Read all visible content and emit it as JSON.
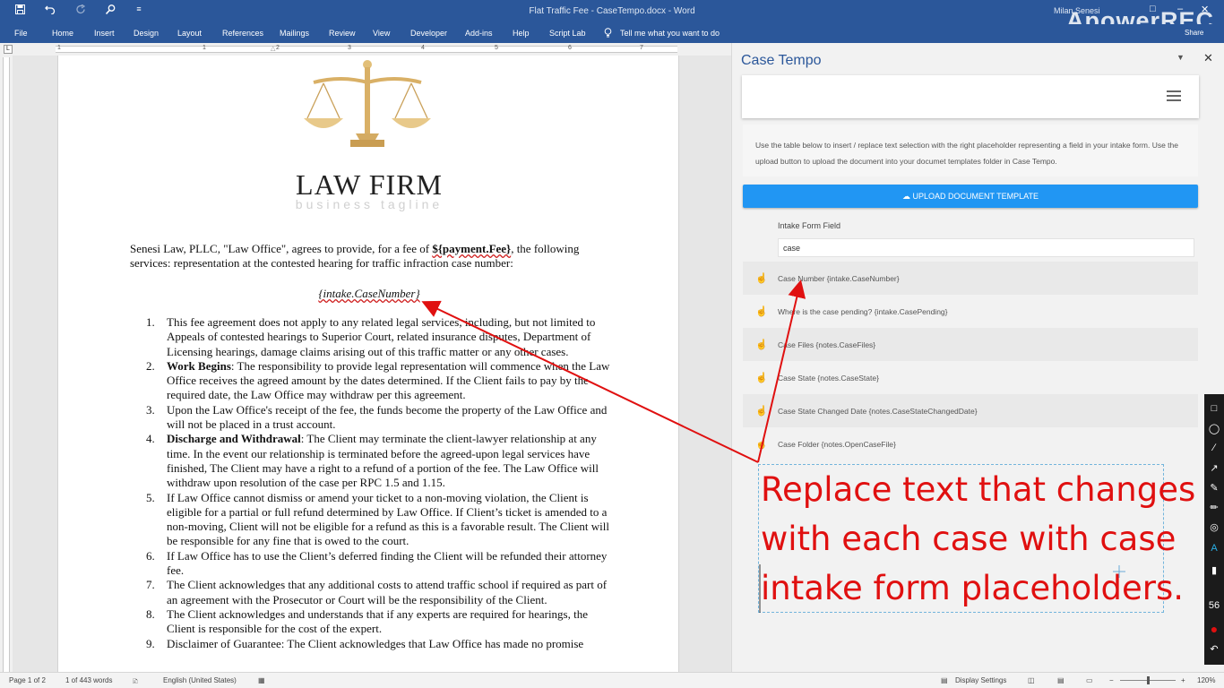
{
  "titlebar": {
    "save_icon": "save-icon",
    "undo_icon": "undo-icon",
    "redo_icon": "redo-icon",
    "touch_icon": "touch-mode-icon",
    "customize_icon": "customize-icon",
    "title": "Flat Traffic Fee - CaseTempo.docx - Word",
    "user": "Milan Senesi",
    "watermark": "ApowerREC",
    "share": "Share"
  },
  "ribbon": {
    "tabs": [
      "File",
      "Home",
      "Insert",
      "Design",
      "Layout",
      "References",
      "Mailings",
      "Review",
      "View",
      "Developer",
      "Add-ins",
      "Help",
      "Script Lab"
    ],
    "tell_me": "Tell me what you want to do"
  },
  "ruler": {
    "numbers": [
      "1",
      "1",
      "2",
      "3",
      "4",
      "5",
      "6",
      "7"
    ]
  },
  "document": {
    "firm_name": "LAW FIRM",
    "tagline": "business tagline",
    "intro_before": "Senesi Law, PLLC, \"Law Office\", agrees to provide, for a fee of ",
    "intro_fee": "${payment.Fee}",
    "intro_after": ", the following services: representation at the contested hearing for traffic infraction case number:",
    "case_number": "{intake.CaseNumber}",
    "items": [
      {
        "num": "1.",
        "bold": "",
        "text": "This fee agreement does not apply to any related legal services, including, but not limited to Appeals of contested hearings to Superior Court, related insurance disputes, Department of Licensing hearings, damage claims arising out of this traffic matter or any other cases."
      },
      {
        "num": "2.",
        "bold": "Work Begins",
        "text": ": The responsibility to provide legal representation will commence when the Law Office receives the agreed amount by the dates determined. If the Client fails to pay by the required date, the Law Office may withdraw per this agreement."
      },
      {
        "num": "3.",
        "bold": "",
        "text": "Upon the Law Office's receipt of the fee, the funds become the property of the Law Office and will not be placed in a trust account."
      },
      {
        "num": "4.",
        "bold": "Discharge and Withdrawal",
        "text": ": The Client may terminate the client-lawyer relationship at any time. In the event our relationship is terminated before the agreed-upon legal services have finished, The Client may have a right to a refund of a portion of the fee. The Law Office will withdraw upon resolution of the case per RPC 1.5 and 1.15."
      },
      {
        "num": "5.",
        "bold": "",
        "text": "If Law Office cannot dismiss or amend your ticket to a non-moving violation, the Client is eligible for a partial or full refund determined by Law Office.  If Client’s ticket is amended to a non-moving, Client will not be eligible for a refund as this is a favorable result. The Client will be responsible for any fine that is owed to the court."
      },
      {
        "num": "6.",
        "bold": "",
        "text": "If Law Office has to use the Client’s deferred finding the Client will be refunded their attorney fee."
      },
      {
        "num": "7.",
        "bold": "",
        "text": "The Client acknowledges that any additional costs to attend traffic school if required as part of an agreement with the Prosecutor or Court will be the responsibility of the Client."
      },
      {
        "num": "8.",
        "bold": "",
        "text": "The Client acknowledges and understands that if any experts are required for hearings, the Client is responsible for the cost of the expert."
      },
      {
        "num": "9.",
        "bold": "",
        "text": "Disclaimer of Guarantee: The Client acknowledges that Law Office has made no promise"
      }
    ]
  },
  "pane": {
    "title": "Case Tempo",
    "collapse_icon": "chevron-down-icon",
    "close_icon": "close-icon",
    "instructions": "Use the table below to insert / replace text selection with the right placeholder representing a field in your intake form. Use the upload button to upload the document into your documet templates folder in Case Tempo.",
    "upload_label": "UPLOAD DOCUMENT TEMPLATE",
    "column_header": "Intake Form Field",
    "filter_value": "case",
    "fields": [
      "Case Number {intake.CaseNumber}",
      "Where is the case pending? {intake.CasePending}",
      "Case Files {notes.CaseFiles}",
      "Case State {notes.CaseState}",
      "Case State Changed Date {notes.CaseStateChangedDate}",
      "Case Folder {notes.OpenCaseFile}"
    ]
  },
  "annotation": {
    "lines": [
      "Replace text that changes",
      "with each case with case",
      "intake form placeholders."
    ],
    "color": "#e01010"
  },
  "recorder_toolbar": {
    "counter": "56"
  },
  "statusbar": {
    "page": "Page 1 of 2",
    "words": "1 of 443 words",
    "language": "English (United States)",
    "display_settings": "Display Settings",
    "zoom": "120%"
  },
  "colors": {
    "word_blue": "#2b579a",
    "upload_blue": "#2196f3"
  }
}
